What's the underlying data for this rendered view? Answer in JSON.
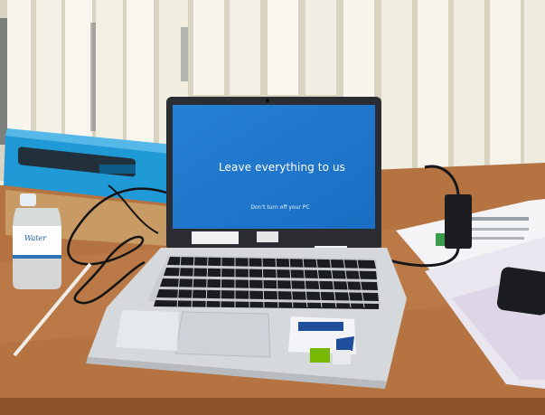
{
  "screen": {
    "main_message": "Leave everything to us",
    "sub_message": "Don't turn off your PC"
  },
  "bottle": {
    "label": "Water"
  },
  "colors": {
    "wall": "#efece0",
    "blinds": "#f6f4ea",
    "desk": "#b5743e",
    "screen": "#1f78cf",
    "laptop_body": "#d6d9dc",
    "keyboard_key": "#1b1c1f",
    "box": "#1f9ad6"
  }
}
